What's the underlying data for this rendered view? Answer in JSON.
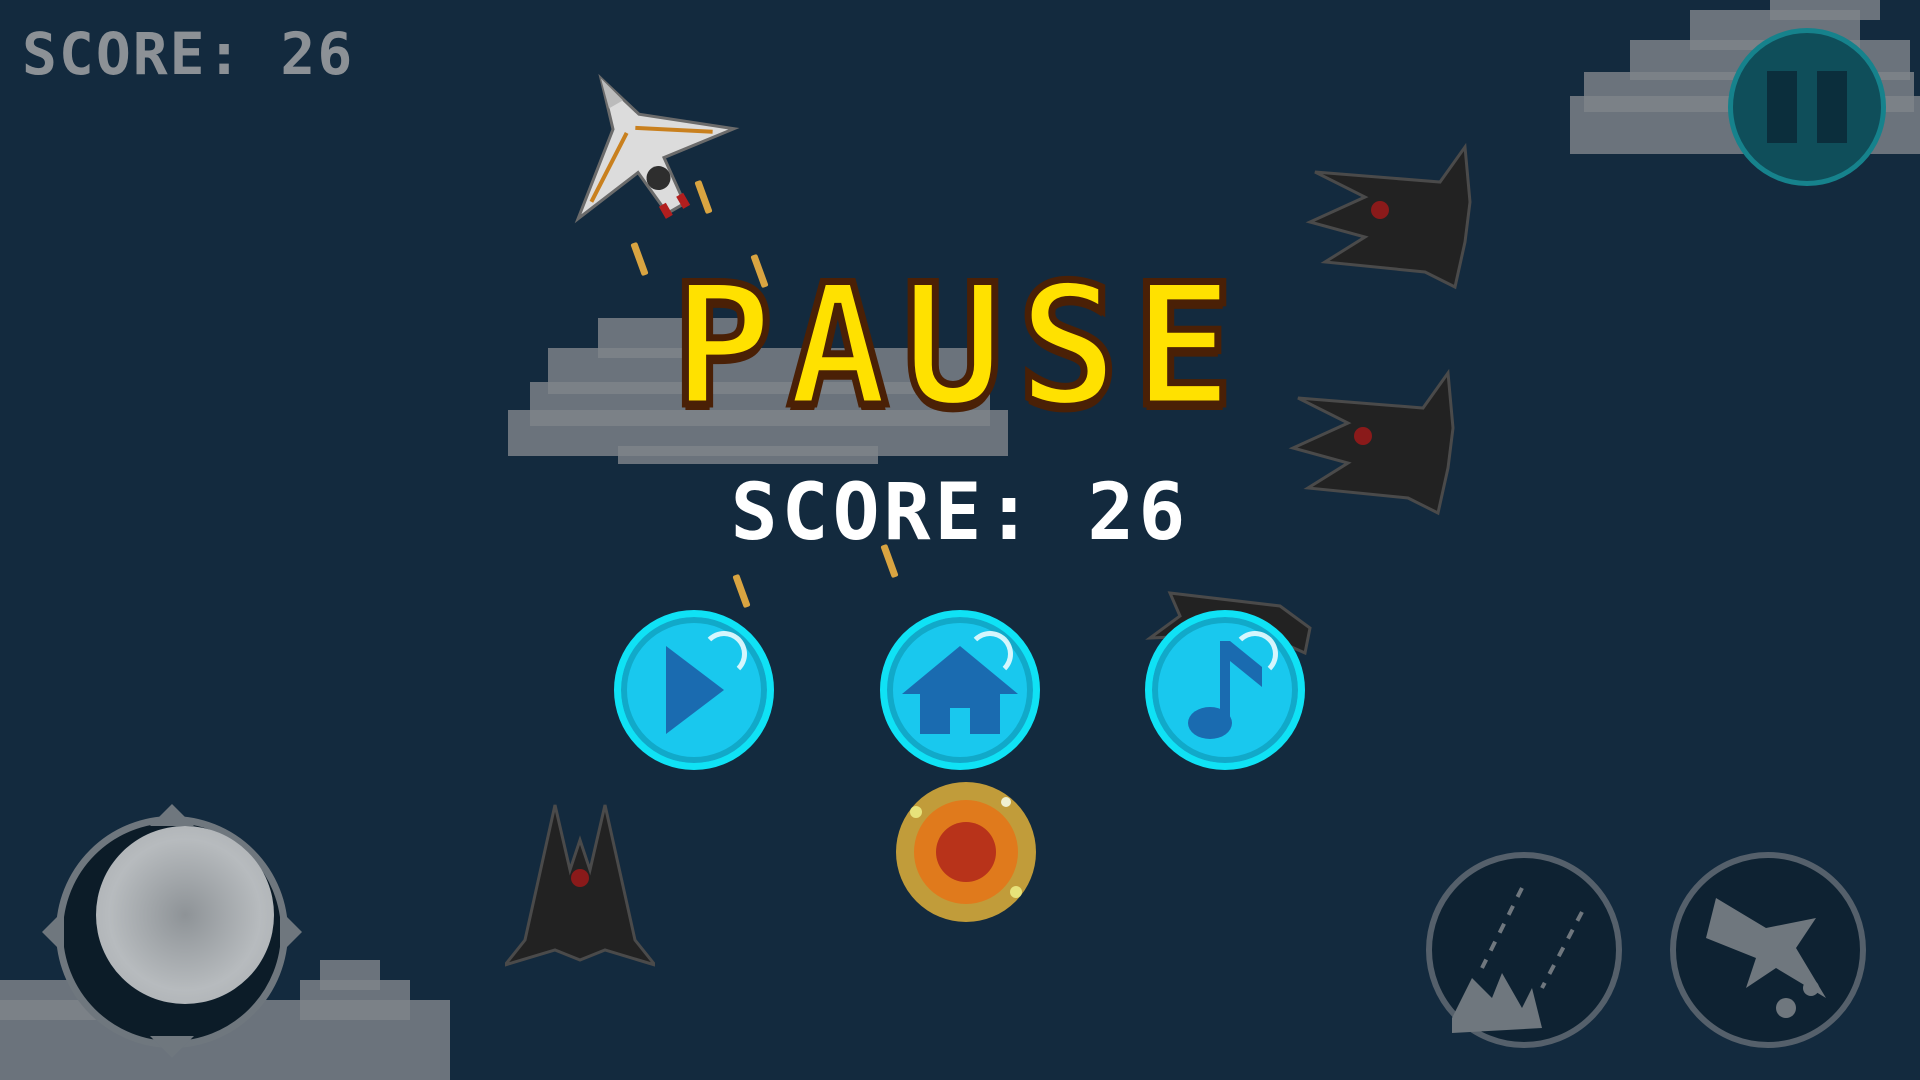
{
  "hud": {
    "score_text": "SCORE: 26"
  },
  "pause_menu": {
    "title": "PAUSE",
    "score_text": "SCORE: 26",
    "buttons": [
      {
        "name": "resume-button",
        "icon": "play-icon"
      },
      {
        "name": "home-button",
        "icon": "home-icon"
      },
      {
        "name": "music-button",
        "icon": "music-note-icon"
      }
    ]
  },
  "controls": {
    "pause_icon": "pause-icon",
    "fire_icon": "missile-fire-icon",
    "special_icon": "jet-special-icon",
    "joystick_icon": "joystick"
  },
  "colors": {
    "background": "#132a3e",
    "title": "#ffe100",
    "title_outline": "#4a2006",
    "menu_button": "#19c8ee",
    "hud_score": "#8c9196"
  }
}
